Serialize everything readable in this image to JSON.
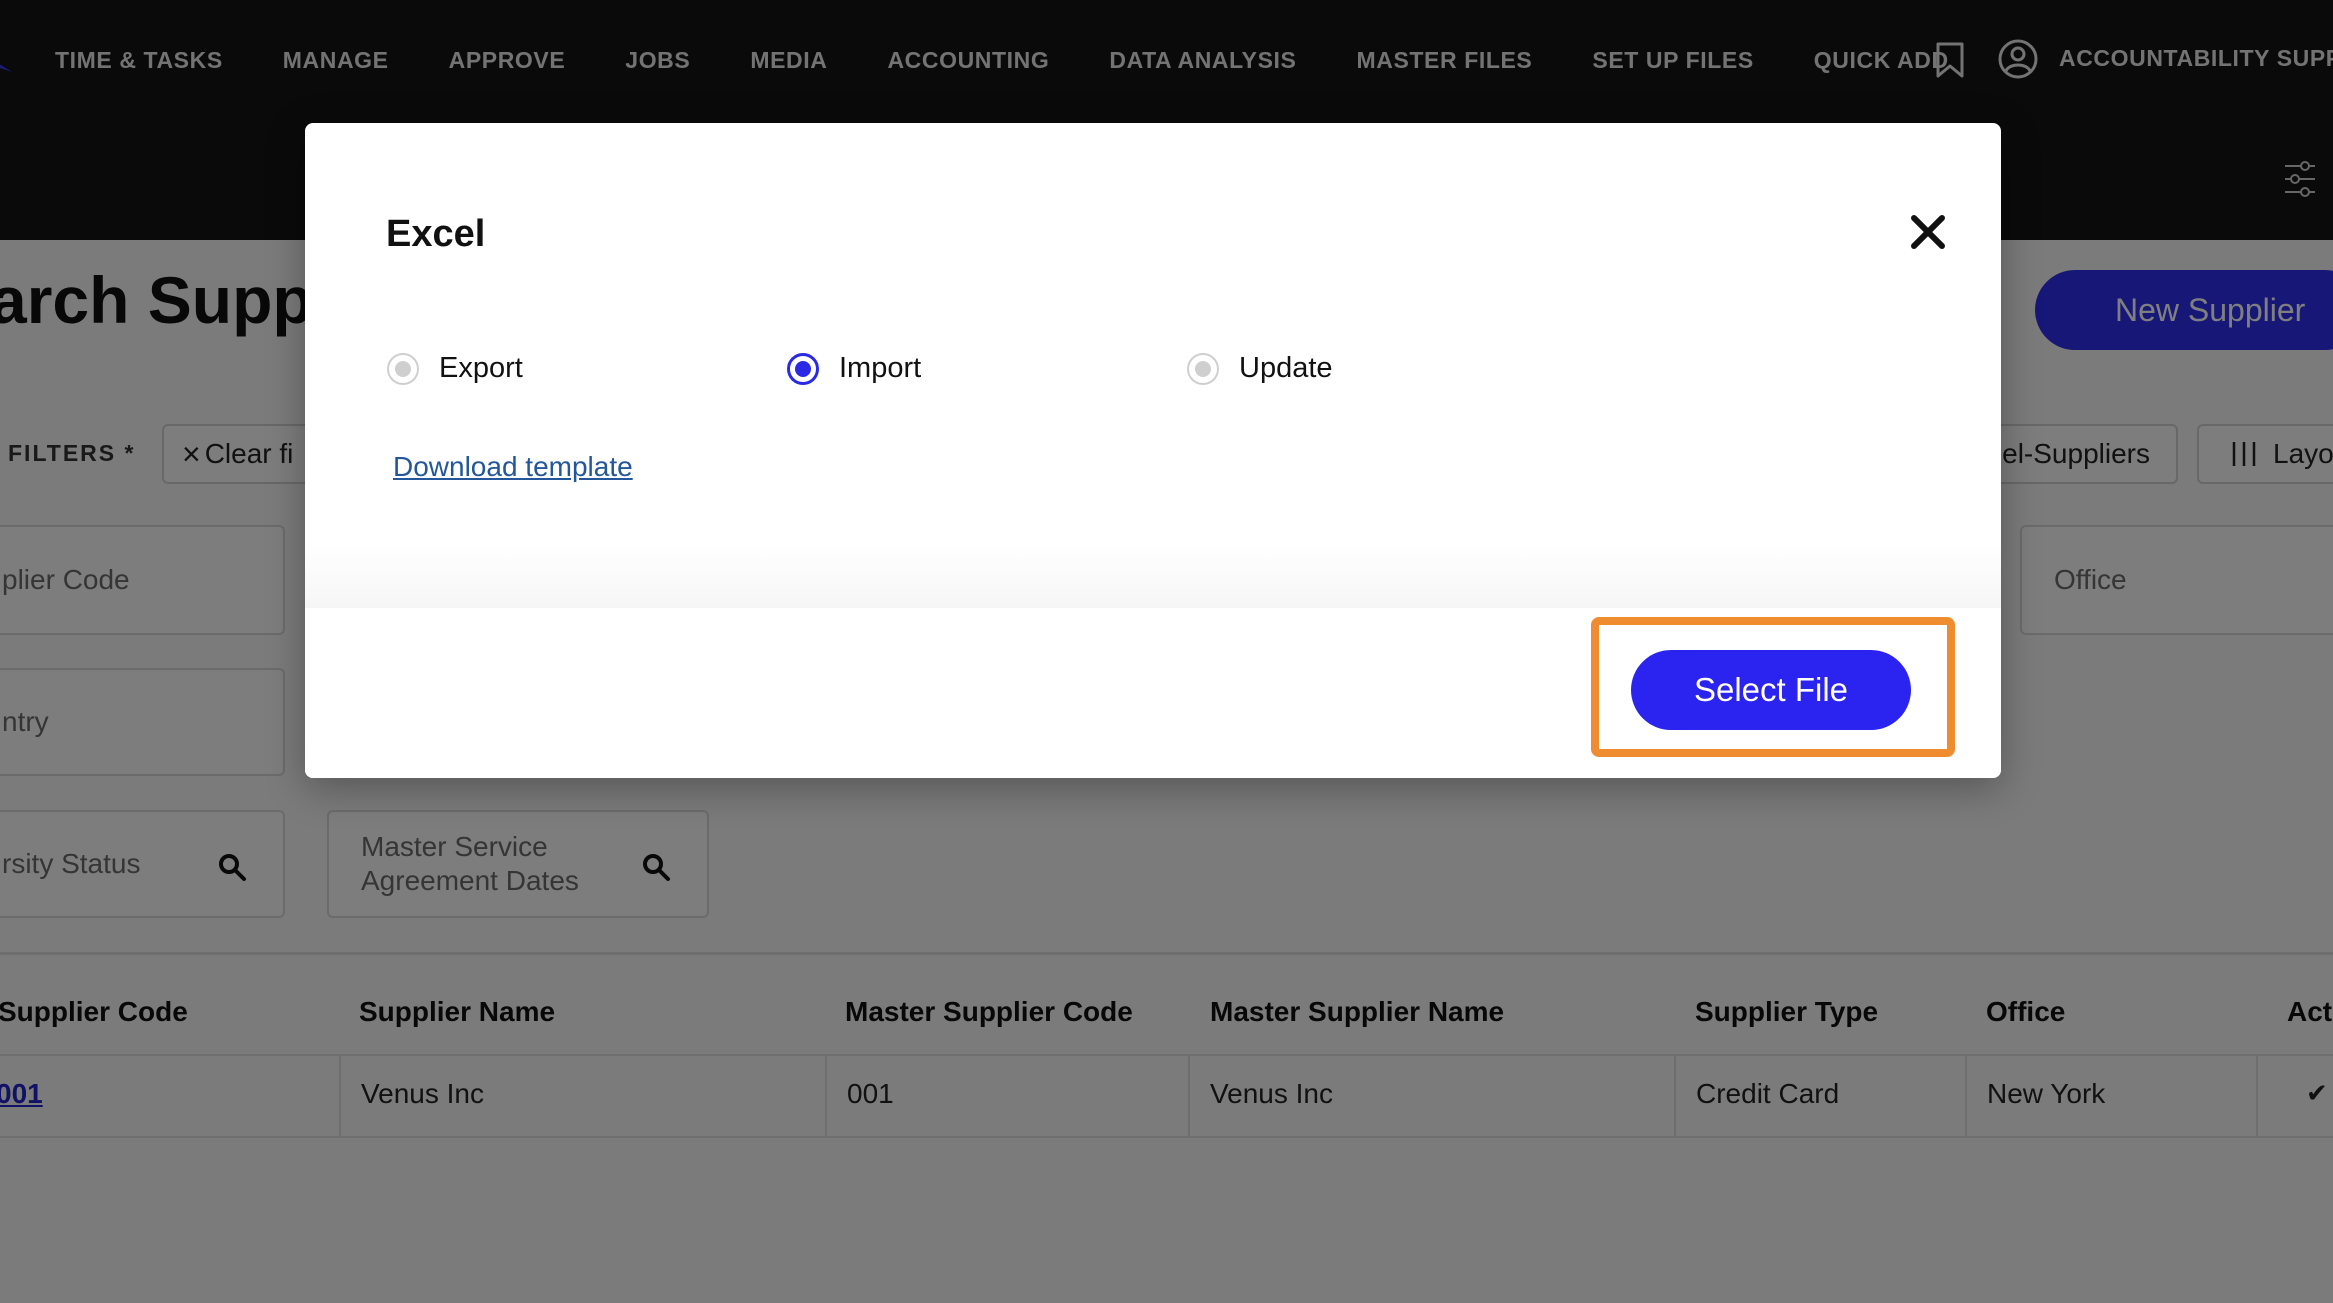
{
  "nav": {
    "items": [
      "TIME & TASKS",
      "MANAGE",
      "APPROVE",
      "JOBS",
      "MEDIA",
      "ACCOUNTING",
      "DATA ANALYSIS",
      "MASTER FILES",
      "SET UP FILES",
      "QUICK ADD"
    ],
    "user_label": "ACCOUNTABILITY SUPP",
    "icons": {
      "bookmark": "bookmark-icon",
      "user": "user-circle-icon",
      "settings": "sliders-icon",
      "logo": "logo-mark"
    }
  },
  "page": {
    "title": "arch Suppl",
    "new_supplier_label": "New Supplier",
    "filters_label": "FILTERS *",
    "clear_filters_label": "Clear fi",
    "excel_suppliers_label": "el-Suppliers",
    "layout_label": "Layo",
    "fields": {
      "supplier_code": "plier Code",
      "country": "ntry",
      "diversity_status": "rsity Status",
      "msa_dates": "Master Service Agreement Dates",
      "office": "Office"
    },
    "table": {
      "headers": [
        "Supplier Code",
        "Supplier Name",
        "Master Supplier Code",
        "Master Supplier Name",
        "Supplier Type",
        "Office",
        "Act"
      ],
      "rows": [
        [
          "001",
          "Venus Inc",
          "001",
          "Venus Inc",
          "Credit Card",
          "New York",
          "✔"
        ]
      ]
    }
  },
  "modal": {
    "title": "Excel",
    "options": [
      {
        "label": "Export",
        "selected": false
      },
      {
        "label": "Import",
        "selected": true
      },
      {
        "label": "Update",
        "selected": false
      }
    ],
    "download_template_label": "Download template",
    "select_file_label": "Select File",
    "highlight_color": "#f08c30",
    "accent_color": "#2b23f0"
  }
}
